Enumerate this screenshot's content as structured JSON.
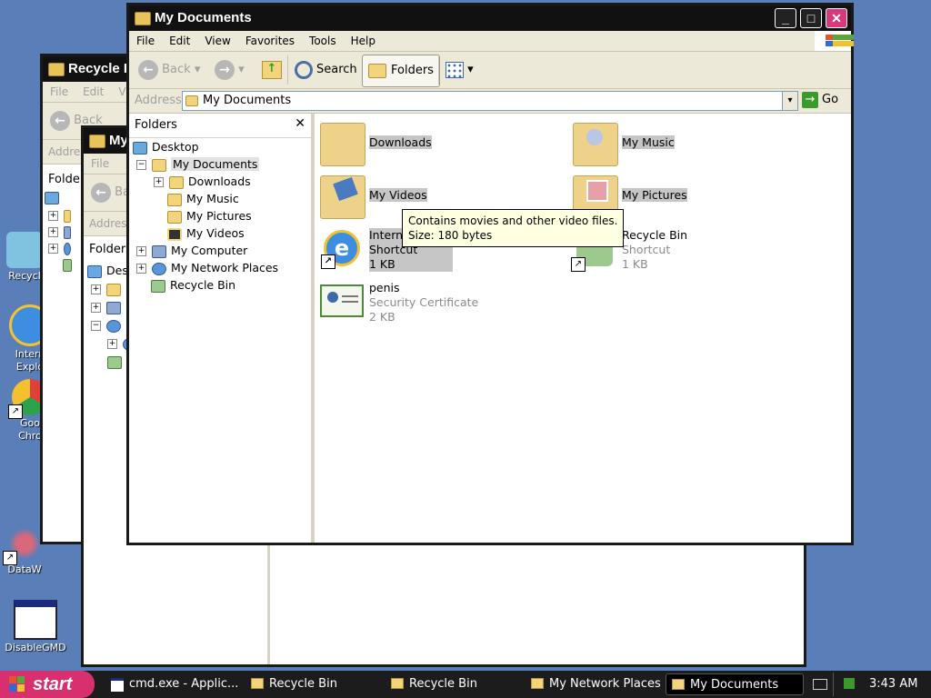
{
  "desktop": {
    "icons": [
      {
        "label": "Recycl"
      },
      {
        "label": "Intern\nExplo"
      },
      {
        "label": "Goo\nChro"
      },
      {
        "label": "DataW"
      },
      {
        "label": "DisableGMD"
      }
    ]
  },
  "bg_windows": {
    "recycle_title": "Recycle B",
    "recycle_menu": [
      "File",
      "Edit",
      "V"
    ],
    "recycle_back": "Back",
    "recycle_address": "Addre",
    "recycle_folders": "Folder",
    "my_title": "My",
    "my_menu": "File",
    "my_back": "Ba",
    "my_address": "Addres",
    "my_folders": "Folders",
    "my_desktop": "Desk"
  },
  "window": {
    "title": "My Documents",
    "menu": [
      "File",
      "Edit",
      "View",
      "Favorites",
      "Tools",
      "Help"
    ],
    "toolbar": {
      "back": "Back",
      "search": "Search",
      "folders": "Folders"
    },
    "address_label": "Address",
    "address_value": "My Documents",
    "go": "Go",
    "folders_pane_title": "Folders",
    "tree": [
      {
        "label": "Desktop"
      },
      {
        "label": "My Documents"
      },
      {
        "label": "Downloads"
      },
      {
        "label": "My Music"
      },
      {
        "label": "My Pictures"
      },
      {
        "label": "My Videos"
      },
      {
        "label": "My Computer"
      },
      {
        "label": "My Network Places"
      },
      {
        "label": "Recycle Bin"
      }
    ],
    "items": [
      {
        "name": "Downloads"
      },
      {
        "name": "My Music"
      },
      {
        "name": "My Videos"
      },
      {
        "name": "My Pictures"
      },
      {
        "name": "Intern",
        "line2": "Shortcut",
        "line3": "1 KB"
      },
      {
        "name": "Recycle Bin",
        "line2": "Shortcut",
        "line3": "1 KB"
      },
      {
        "name": "penis",
        "line2": "Security Certificate",
        "line3": "2 KB"
      }
    ],
    "tooltip": {
      "line1": "Contains movies and other video files.",
      "line2": "Size: 180 bytes"
    }
  },
  "taskbar": {
    "start": "start",
    "tasks": [
      {
        "label": "cmd.exe - Applic..."
      },
      {
        "label": "Recycle Bin"
      },
      {
        "label": "Recycle Bin"
      },
      {
        "label": "My Network Places"
      },
      {
        "label": "My Documents"
      }
    ],
    "clock": "3:43 AM"
  },
  "colors": {
    "desktop": "#5a7eb8",
    "titlebar": "#111111",
    "start": "#d8306e",
    "close": "#d63a7a"
  }
}
